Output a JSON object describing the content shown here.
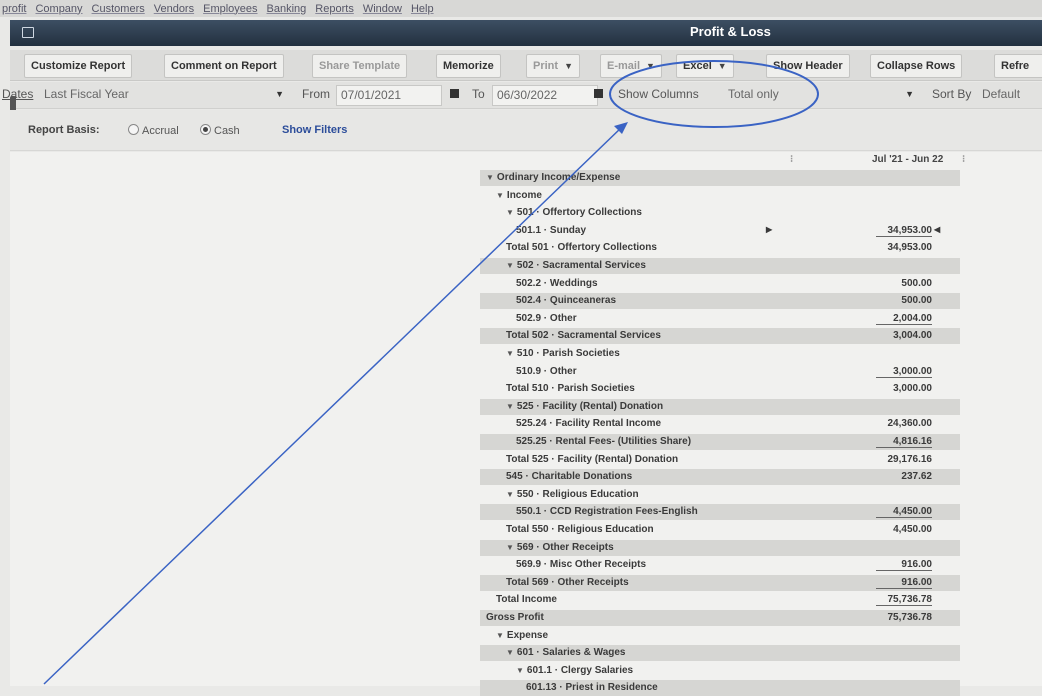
{
  "menubar": {
    "items": [
      "profit",
      "Company",
      "Customers",
      "Vendors",
      "Employees",
      "Banking",
      "Reports",
      "Window",
      "Help"
    ]
  },
  "window": {
    "title": "Profit & Loss"
  },
  "toolbar": {
    "customize": "Customize Report",
    "comment": "Comment on Report",
    "share": "Share Template",
    "memorize": "Memorize",
    "print": "Print",
    "email": "E-mail",
    "excel": "Excel",
    "show_header": "Show Header",
    "collapse": "Collapse Rows",
    "refresh": "Refre"
  },
  "datesbar": {
    "dates_label": "Dates",
    "dates_value": "Last Fiscal Year",
    "from_label": "From",
    "from_value": "07/01/2021",
    "to_label": "To",
    "to_value": "06/30/2022",
    "show_columns_label": "Show Columns",
    "show_columns_value": "Total only",
    "sort_by_label": "Sort By",
    "sort_by_value": "Default"
  },
  "basis": {
    "label": "Report Basis:",
    "accrual": "Accrual",
    "cash": "Cash",
    "selected": "cash",
    "show_filters": "Show Filters"
  },
  "report": {
    "column_header": "Jul '21 - Jun 22",
    "rows": [
      {
        "label": "Ordinary Income/Expense",
        "amount": "",
        "indent": 0,
        "caret": true,
        "highlight": true
      },
      {
        "label": "Income",
        "amount": "",
        "indent": 1,
        "caret": true
      },
      {
        "label": "501 · Offertory Collections",
        "amount": "",
        "indent": 2,
        "caret": true
      },
      {
        "label": "501.1 · Sunday",
        "amount": "34,953.00",
        "indent": 3,
        "marker": true,
        "underline": true
      },
      {
        "label": "Total 501 · Offertory Collections",
        "amount": "34,953.00",
        "indent": 2
      },
      {
        "label": "502 · Sacramental Services",
        "amount": "",
        "indent": 2,
        "caret": true,
        "highlight": true
      },
      {
        "label": "502.2 · Weddings",
        "amount": "500.00",
        "indent": 3
      },
      {
        "label": "502.4 · Quinceaneras",
        "amount": "500.00",
        "indent": 3,
        "highlight": true
      },
      {
        "label": "502.9 · Other",
        "amount": "2,004.00",
        "indent": 3,
        "underline": true
      },
      {
        "label": "Total 502 · Sacramental Services",
        "amount": "3,004.00",
        "indent": 2,
        "highlight": true
      },
      {
        "label": "510 · Parish Societies",
        "amount": "",
        "indent": 2,
        "caret": true
      },
      {
        "label": "510.9 · Other",
        "amount": "3,000.00",
        "indent": 3,
        "underline": true
      },
      {
        "label": "Total 510 · Parish Societies",
        "amount": "3,000.00",
        "indent": 2
      },
      {
        "label": "525 · Facility (Rental) Donation",
        "amount": "",
        "indent": 2,
        "caret": true,
        "highlight": true
      },
      {
        "label": "525.24 · Facility Rental Income",
        "amount": "24,360.00",
        "indent": 3
      },
      {
        "label": "525.25 · Rental Fees- (Utilities Share)",
        "amount": "4,816.16",
        "indent": 3,
        "underline": true,
        "highlight": true
      },
      {
        "label": "Total 525 · Facility (Rental) Donation",
        "amount": "29,176.16",
        "indent": 2
      },
      {
        "label": "545 · Charitable Donations",
        "amount": "237.62",
        "indent": 2,
        "highlight": true
      },
      {
        "label": "550 · Religious Education",
        "amount": "",
        "indent": 2,
        "caret": true
      },
      {
        "label": "550.1 · CCD Registration Fees-English",
        "amount": "4,450.00",
        "indent": 3,
        "underline": true,
        "highlight": true
      },
      {
        "label": "Total 550 · Religious Education",
        "amount": "4,450.00",
        "indent": 2
      },
      {
        "label": "569 · Other Receipts",
        "amount": "",
        "indent": 2,
        "caret": true,
        "highlight": true
      },
      {
        "label": "569.9 · Misc Other Receipts",
        "amount": "916.00",
        "indent": 3,
        "underline": true
      },
      {
        "label": "Total 569 · Other Receipts",
        "amount": "916.00",
        "indent": 2,
        "underline": true,
        "highlight": true
      },
      {
        "label": "Total Income",
        "amount": "75,736.78",
        "indent": 1,
        "underline": true
      },
      {
        "label": "Gross Profit",
        "amount": "75,736.78",
        "indent": 0,
        "highlight": true
      },
      {
        "label": "Expense",
        "amount": "",
        "indent": 1,
        "caret": true
      },
      {
        "label": "601 · Salaries & Wages",
        "amount": "",
        "indent": 2,
        "caret": true,
        "highlight": true
      },
      {
        "label": "601.1 · Clergy Salaries",
        "amount": "",
        "indent": 3,
        "caret": true
      },
      {
        "label": "601.13 · Priest in Residence",
        "amount": "",
        "indent": 4,
        "highlight": true
      }
    ]
  },
  "colors": {
    "annotation": "#3a63c4",
    "title_bar": "#2b3a4b"
  }
}
